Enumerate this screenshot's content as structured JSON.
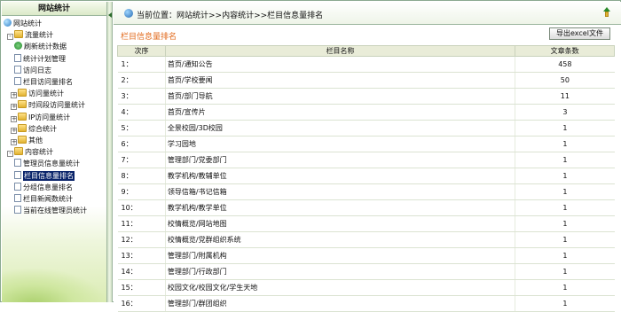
{
  "sidebar": {
    "title": "网站统计",
    "tree": [
      {
        "label": "网站统计",
        "icon": "globe-icon",
        "toggle": ""
      },
      {
        "label": "流量统计",
        "icon": "folder-icon",
        "toggle": "-"
      },
      {
        "label": "刷新统计数据",
        "icon": "refresh-icon",
        "toggle": ""
      },
      {
        "label": "统计计划管理",
        "icon": "page-icon",
        "toggle": ""
      },
      {
        "label": "访问日志",
        "icon": "page-icon",
        "toggle": ""
      },
      {
        "label": "栏目访问量排名",
        "icon": "page-icon",
        "toggle": ""
      },
      {
        "label": "访问量统计",
        "icon": "folder-icon",
        "toggle": "+"
      },
      {
        "label": "时间段访问量统计",
        "icon": "folder-icon",
        "toggle": "+"
      },
      {
        "label": "IP访问量统计",
        "icon": "folder-icon",
        "toggle": "+"
      },
      {
        "label": "综合统计",
        "icon": "folder-icon",
        "toggle": "+"
      },
      {
        "label": "其他",
        "icon": "folder-icon",
        "toggle": "+"
      },
      {
        "label": "内容统计",
        "icon": "folder-icon",
        "toggle": "-"
      },
      {
        "label": "管理员信息量统计",
        "icon": "page-icon",
        "toggle": ""
      },
      {
        "label": "栏目信息量排名",
        "icon": "page-icon",
        "toggle": "",
        "selected": true
      },
      {
        "label": "分组信息量排名",
        "icon": "page-icon",
        "toggle": ""
      },
      {
        "label": "栏目新闻数统计",
        "icon": "page-icon",
        "toggle": ""
      },
      {
        "label": "当前在线管理员统计",
        "icon": "page-icon",
        "toggle": ""
      }
    ]
  },
  "header": {
    "breadcrumb": "当前位置：网站统计>>内容统计>>栏目信息量排名",
    "up_icon": "up-folder-icon"
  },
  "main": {
    "section_title": "栏目信息量排名",
    "export_label": "导出excel文件",
    "columns": [
      "次序",
      "栏目名称",
      "文章条数"
    ],
    "rows": [
      [
        "1：",
        "首页/通知公告",
        "458"
      ],
      [
        "2：",
        "首页/学校要闻",
        "50"
      ],
      [
        "3：",
        "首页/部门导航",
        "11"
      ],
      [
        "4：",
        "首页/宣传片",
        "3"
      ],
      [
        "5：",
        "全景校园/3D校园",
        "1"
      ],
      [
        "6：",
        "学习园地",
        "1"
      ],
      [
        "7：",
        "管理部门/党委部门",
        "1"
      ],
      [
        "8：",
        "教学机构/教辅单位",
        "1"
      ],
      [
        "9：",
        "领导信箱/书记信箱",
        "1"
      ],
      [
        "10：",
        "教学机构/教学单位",
        "1"
      ],
      [
        "11：",
        "校情概览/网站地图",
        "1"
      ],
      [
        "12：",
        "校情概览/党群组织系统",
        "1"
      ],
      [
        "13：",
        "管理部门/附属机构",
        "1"
      ],
      [
        "14：",
        "管理部门/行政部门",
        "1"
      ],
      [
        "15：",
        "校园文化/校园文化/学生天地",
        "1"
      ],
      [
        "16：",
        "管理部门/群团组织",
        "1"
      ]
    ]
  }
}
